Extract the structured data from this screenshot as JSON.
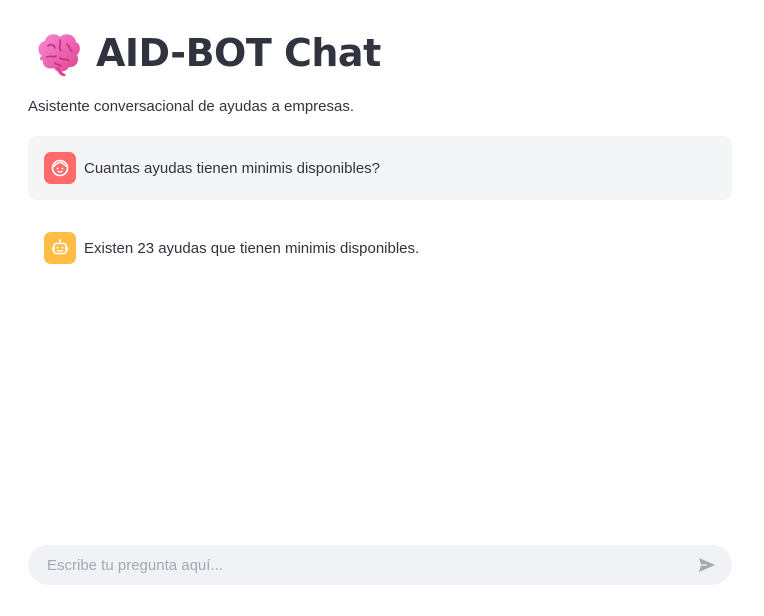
{
  "header": {
    "title": "AID-BOT Chat",
    "title_icon": "brain-icon",
    "subtitle": "Asistente conversacional de ayudas a empresas."
  },
  "messages": [
    {
      "role": "user",
      "avatar_icon": "user-face-icon",
      "avatar_color": "#ff6b6b",
      "text": "Cuantas ayudas tienen minimis disponibles?"
    },
    {
      "role": "assistant",
      "avatar_icon": "robot-icon",
      "avatar_color": "#ffbd45",
      "text": "Existen 23 ayudas que tienen minimis disponibles."
    }
  ],
  "chat_input": {
    "value": "",
    "placeholder": "Escribe tu pregunta aquí...",
    "send_icon": "send-icon"
  }
}
